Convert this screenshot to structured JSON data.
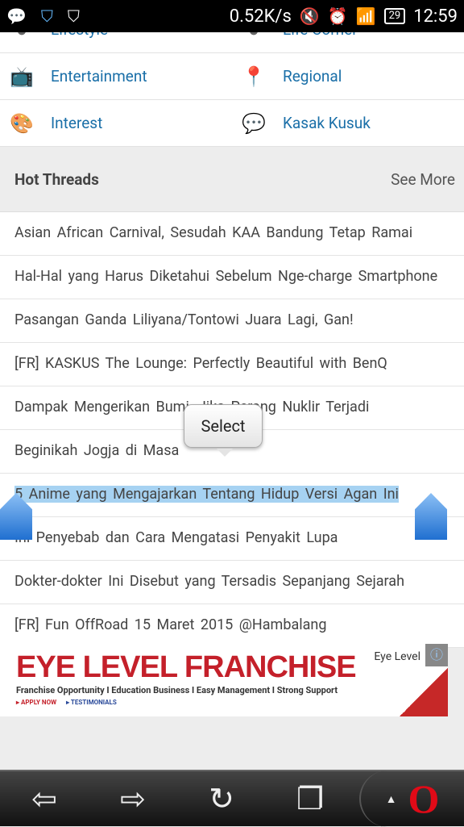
{
  "status": {
    "speed": "0.52K/s",
    "battery": "29",
    "time": "12:59",
    "icons": [
      "bbm-icon",
      "shield-icon",
      "shield-check-icon",
      "mute-icon",
      "alarm-icon",
      "signal-icon",
      "signal2-icon"
    ]
  },
  "categories": [
    [
      {
        "label": "Lifestyle",
        "icon": "lifestyle-icon"
      },
      {
        "label": "Life Corner",
        "icon": "life-corner-icon"
      }
    ],
    [
      {
        "label": "Entertainment",
        "icon": "tv-icon"
      },
      {
        "label": "Regional",
        "icon": "location-pin-icon"
      }
    ],
    [
      {
        "label": "Interest",
        "icon": "palette-icon"
      },
      {
        "label": "Kasak Kusuk",
        "icon": "chat-icon"
      }
    ]
  ],
  "hot": {
    "title": "Hot Threads",
    "more": "See More",
    "threads": [
      "Asian African Carnival, Sesudah KAA Bandung Tetap Ramai",
      "Hal-Hal yang Harus Diketahui Sebelum Nge-charge Smartphone",
      "Pasangan Ganda Liliyana/Tontowi Juara Lagi, Gan!",
      "[FR] KASKUS The Lounge: Perfectly Beautiful with BenQ",
      "Dampak Mengerikan Bumi, Jika Perang Nuklir Terjadi",
      "Beginikah Jogja di Masa",
      "5 Anime yang Mengajarkan Tentang Hidup Versi Agan Ini",
      "Ini Penyebab dan Cara Mengatasi Penyakit Lupa",
      "Dokter-dokter Ini Disebut yang Tersadis Sepanjang Sejarah",
      "[FR] Fun OffRoad 15 Maret 2015 @Hambalang"
    ],
    "selected_index": 6
  },
  "select_popup": "Select",
  "ad": {
    "headline": "EYE LEVEL FRANCHISE",
    "sub": "Franchise Opportunity I Education Business I Easy Management I Strong Support",
    "apply": "▸ APPLY NOW",
    "testimonials": "▸ TESTIMONIALS",
    "brand": "Eye Level"
  },
  "nav": {
    "back": "⇦",
    "forward": "⇨",
    "reload": "↻",
    "tabs": "❐",
    "up": "▲",
    "opera": "O"
  }
}
